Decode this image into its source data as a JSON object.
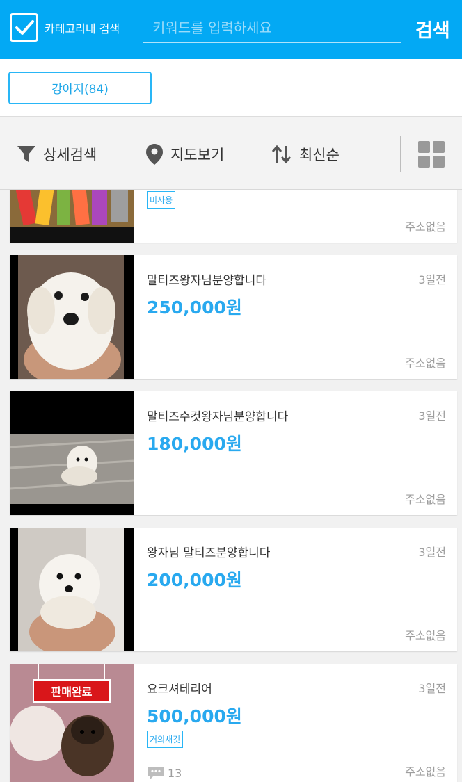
{
  "header": {
    "category_checkbox_label": "카테고리내 검색",
    "category_checkbox_checked": true,
    "search_placeholder": "키워드를 입력하세요",
    "search_value": "",
    "search_button": "검색",
    "accent_color": "#03a9f4"
  },
  "category": {
    "chip_label": "강아지(84)"
  },
  "filters": {
    "detail_search": "상세검색",
    "map_view": "지도보기",
    "sort": "최신순",
    "icons": [
      "filter-icon",
      "map-pin-icon",
      "sort-icon",
      "grid-view-icon"
    ]
  },
  "listings": [
    {
      "title": "",
      "time": "",
      "price": "",
      "tag": "미사용",
      "address": "주소없음",
      "sold": false,
      "comments": ""
    },
    {
      "title": "말티즈왕자님분양합니다",
      "time": "3일전",
      "price": "250,000원",
      "tag": "",
      "address": "주소없음",
      "sold": false,
      "comments": ""
    },
    {
      "title": "말티즈수컷왕자님분양합니다",
      "time": "3일전",
      "price": "180,000원",
      "tag": "",
      "address": "주소없음",
      "sold": false,
      "comments": ""
    },
    {
      "title": "왕자님 말티즈분양합니다",
      "time": "3일전",
      "price": "200,000원",
      "tag": "",
      "address": "주소없음",
      "sold": false,
      "comments": ""
    },
    {
      "title": "요크셔테리어",
      "time": "3일전",
      "price": "500,000원",
      "tag": "거의새것",
      "address": "주소없음",
      "sold": true,
      "sold_label": "판매완료",
      "comments": "13"
    }
  ]
}
